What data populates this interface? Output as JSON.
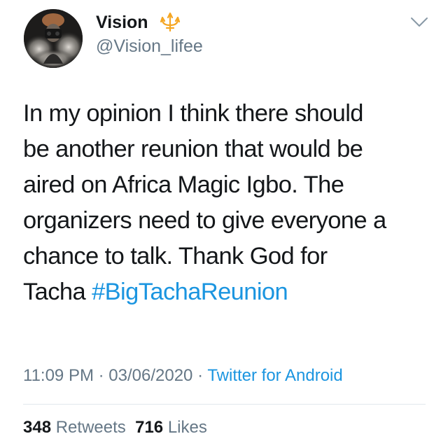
{
  "author": {
    "display_name": "Vision",
    "handle": "@Vision_lifee",
    "badge_icon": "trident-icon",
    "avatar": "profile-photo"
  },
  "tweet": {
    "lines": [
      "In my opinion I think there should",
      "be another reunion that would be",
      "aired on Africa Magic Igbo. The",
      "organizers need to give everyone a",
      "chance to talk. Thank God for"
    ],
    "last_line_text": "Tacha ",
    "hashtag": "#BigTachaReunion"
  },
  "meta": {
    "time": "11:09 PM",
    "separator": " · ",
    "date": "03/06/2020",
    "source": "Twitter for Android"
  },
  "stats": {
    "retweets_count": "348",
    "retweets_label": " Retweets",
    "likes_count": "716",
    "likes_label": " Likes"
  },
  "colors": {
    "link": "#1b95e0",
    "secondary_text": "#657786",
    "primary_text": "#14171a",
    "badge": "#f5a623"
  },
  "menu_icon": "chevron-down-icon"
}
